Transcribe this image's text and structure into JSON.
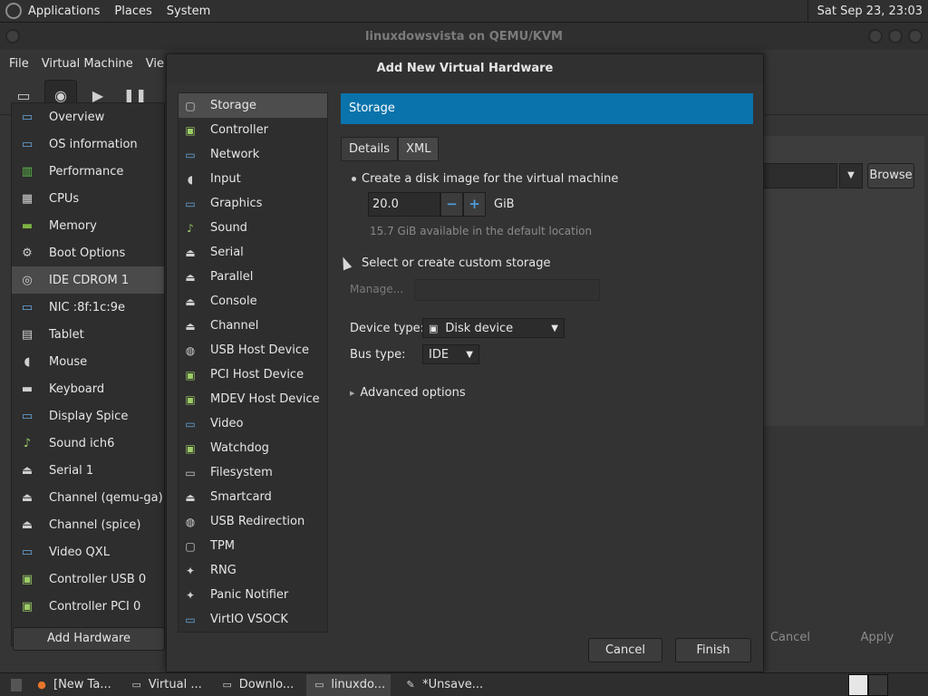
{
  "top_panel": {
    "menus": [
      "Applications",
      "Places",
      "System"
    ],
    "clock": "Sat Sep 23, 23:03"
  },
  "vm_window": {
    "title": "linuxdowsvista on QEMU/KVM",
    "menus": [
      "File",
      "Virtual Machine",
      "Vie"
    ],
    "devices": [
      {
        "label": "Overview",
        "icon": "monitor-icon"
      },
      {
        "label": "OS information",
        "icon": "monitor-icon"
      },
      {
        "label": "Performance",
        "icon": "chart-icon"
      },
      {
        "label": "CPUs",
        "icon": "cpu-icon"
      },
      {
        "label": "Memory",
        "icon": "memory-icon"
      },
      {
        "label": "Boot Options",
        "icon": "gear-icon"
      },
      {
        "label": "IDE CDROM 1",
        "icon": "cdrom-icon"
      },
      {
        "label": "NIC :8f:1c:9e",
        "icon": "network-icon"
      },
      {
        "label": "Tablet",
        "icon": "tablet-icon"
      },
      {
        "label": "Mouse",
        "icon": "mouse-icon"
      },
      {
        "label": "Keyboard",
        "icon": "keyboard-icon"
      },
      {
        "label": "Display Spice",
        "icon": "monitor-icon"
      },
      {
        "label": "Sound ich6",
        "icon": "sound-icon"
      },
      {
        "label": "Serial 1",
        "icon": "serial-icon"
      },
      {
        "label": "Channel (qemu-ga)",
        "icon": "serial-icon"
      },
      {
        "label": "Channel (spice)",
        "icon": "serial-icon"
      },
      {
        "label": "Video QXL",
        "icon": "monitor-icon"
      },
      {
        "label": "Controller USB 0",
        "icon": "controller-icon"
      },
      {
        "label": "Controller PCI 0",
        "icon": "controller-icon"
      }
    ],
    "selected_device": 6,
    "add_hardware_label": "Add Hardware",
    "browse_label": "Browse",
    "cancel_label": "Cancel",
    "apply_label": "Apply"
  },
  "dialog": {
    "title": "Add New Virtual Hardware",
    "hardware_types": [
      {
        "label": "Storage",
        "icon": "storage-icon"
      },
      {
        "label": "Controller",
        "icon": "controller-icon"
      },
      {
        "label": "Network",
        "icon": "network-icon"
      },
      {
        "label": "Input",
        "icon": "mouse-icon"
      },
      {
        "label": "Graphics",
        "icon": "monitor-icon"
      },
      {
        "label": "Sound",
        "icon": "sound-icon"
      },
      {
        "label": "Serial",
        "icon": "serial-icon"
      },
      {
        "label": "Parallel",
        "icon": "serial-icon"
      },
      {
        "label": "Console",
        "icon": "serial-icon"
      },
      {
        "label": "Channel",
        "icon": "serial-icon"
      },
      {
        "label": "USB Host Device",
        "icon": "usb-icon"
      },
      {
        "label": "PCI Host Device",
        "icon": "controller-icon"
      },
      {
        "label": "MDEV Host Device",
        "icon": "controller-icon"
      },
      {
        "label": "Video",
        "icon": "monitor-icon"
      },
      {
        "label": "Watchdog",
        "icon": "controller-icon"
      },
      {
        "label": "Filesystem",
        "icon": "folder-icon"
      },
      {
        "label": "Smartcard",
        "icon": "serial-icon"
      },
      {
        "label": "USB Redirection",
        "icon": "usb-icon"
      },
      {
        "label": "TPM",
        "icon": "storage-icon"
      },
      {
        "label": "RNG",
        "icon": "rng-icon"
      },
      {
        "label": "Panic Notifier",
        "icon": "rng-icon"
      },
      {
        "label": "VirtIO VSOCK",
        "icon": "network-icon"
      }
    ],
    "selected_type": 0,
    "pane_header": "Storage",
    "tabs": [
      "Details",
      "XML"
    ],
    "create_disk_label": "Create a disk image for the virtual machine",
    "disk_size": "20.0",
    "disk_unit": "GiB",
    "available_hint": "15.7 GiB available in the default location",
    "custom_storage_label": "Select or create custom storage",
    "manage_label": "Manage...",
    "device_type_label": "Device type:",
    "device_type_value": "Disk device",
    "bus_type_label": "Bus type:",
    "bus_type_value": "IDE",
    "advanced_label": "Advanced options",
    "cancel_label": "Cancel",
    "finish_label": "Finish",
    "accent_color": "#0a73ab"
  },
  "taskbar": {
    "tasks": [
      {
        "label": "[New Ta...",
        "icon": "firefox-icon"
      },
      {
        "label": "Virtual ...",
        "icon": "vm-icon"
      },
      {
        "label": "Downlo...",
        "icon": "folder-icon"
      },
      {
        "label": "linuxdo...",
        "icon": "vm-icon"
      },
      {
        "label": "*Unsave...",
        "icon": "editor-icon"
      }
    ],
    "active_task": 3
  }
}
